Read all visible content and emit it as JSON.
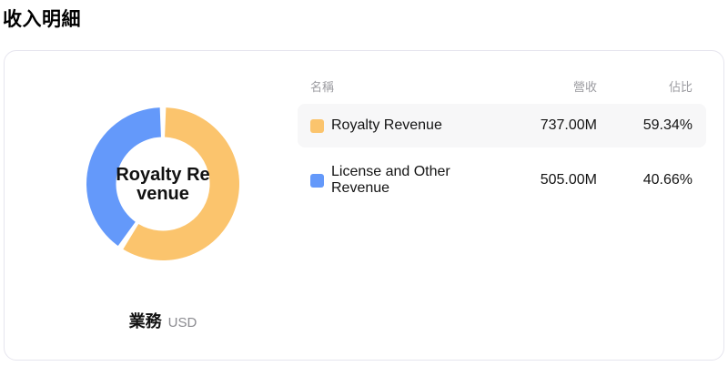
{
  "page": {
    "title": "收入明細"
  },
  "chart_data": {
    "type": "pie",
    "title": "收入明細",
    "center_label": "Royalty Revenue",
    "dimension_label": "業務",
    "unit": "USD",
    "legend_position": "right",
    "donut": true,
    "series": [
      {
        "name": "Royalty Revenue",
        "revenue": "737.00M",
        "percent": 59.34,
        "percent_label": "59.34%",
        "color": "#FBC46D"
      },
      {
        "name": "License and Other Revenue",
        "revenue": "505.00M",
        "percent": 40.66,
        "percent_label": "40.66%",
        "color": "#6499FA"
      }
    ]
  },
  "table": {
    "headers": [
      "名稱",
      "營收",
      "佔比"
    ],
    "rows": [
      {
        "name": "Royalty Revenue",
        "revenue": "737.00M",
        "percent": "59.34%"
      },
      {
        "name": "License and Other Revenue",
        "revenue": "505.00M",
        "percent": "40.66%"
      }
    ]
  }
}
